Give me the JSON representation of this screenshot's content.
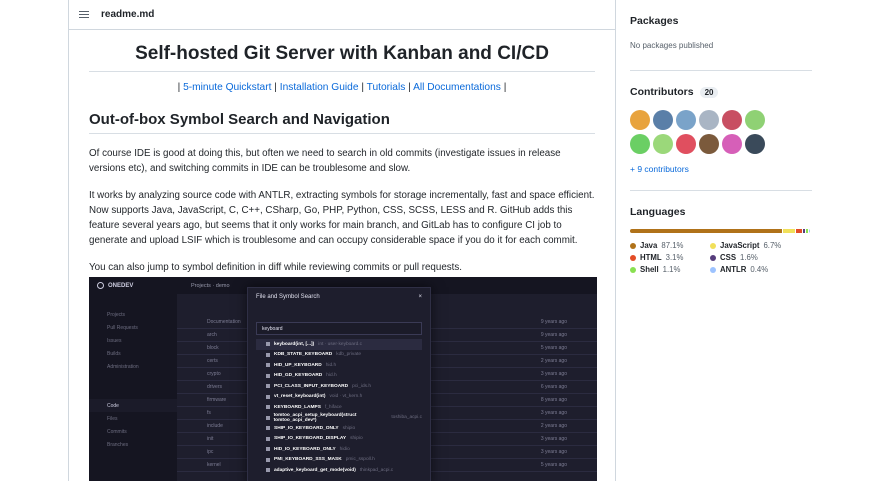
{
  "readme": {
    "file_name": "readme.md",
    "title": "Self-hosted Git Server with Kanban and CI/CD",
    "links": [
      "5-minute Quickstart",
      "Installation Guide",
      "Tutorials",
      "All Documentations"
    ],
    "section_heading": "Out-of-box Symbol Search and Navigation",
    "paragraphs": [
      "Of course IDE is good at doing this, but often we need to search in old commits (investigate issues in release versions etc), and switching commits in IDE can be troublesome and slow.",
      "It works by analyzing source code with ANTLR, extracting symbols for storage incrementally, fast and space efficient. Now supports Java, JavaScript, C, C++, CSharp, Go, PHP, Python, CSS, SCSS, LESS and R. GitHub adds this feature several years ago, but seems that it only works for main branch, and GitLab has to configure CI job to generate and upload LSIF which is troublesome and can occupy considerable space if you do it for each commit.",
      "You can also jump to symbol definition in diff while reviewing commits or pull requests."
    ]
  },
  "screenshot": {
    "logo": "ONEDEV",
    "breadcrumb": "Projects · demo",
    "side_items": [
      "Projects",
      "Pull Requests",
      "Issues",
      "Builds",
      "Administration",
      "",
      "",
      "Code",
      "Files",
      "Commits",
      "Branches"
    ],
    "files": [
      {
        "name": "Documentation",
        "time": "9 years ago"
      },
      {
        "name": "arch",
        "time": "9 years ago"
      },
      {
        "name": "block",
        "time": "5 years ago"
      },
      {
        "name": "certs",
        "time": "2 years ago"
      },
      {
        "name": "crypto",
        "time": "3 years ago"
      },
      {
        "name": "drivers",
        "time": "6 years ago"
      },
      {
        "name": "firmware",
        "time": "8 years ago"
      },
      {
        "name": "fs",
        "time": "3 years ago"
      },
      {
        "name": "include",
        "time": "2 years ago"
      },
      {
        "name": "init",
        "time": "3 years ago"
      },
      {
        "name": "ipc",
        "time": "3 years ago"
      },
      {
        "name": "kernel",
        "time": "5 years ago"
      }
    ],
    "modal": {
      "title": "File and Symbol Search",
      "close": "×",
      "query": "keyboard",
      "results": [
        {
          "name": "keyboard(int, [...])",
          "path": "int · user·keyboard.c"
        },
        {
          "name": "KDB_STATE_KEYBOARD",
          "path": "kdb_private"
        },
        {
          "name": "HID_UP_KEYBOARD",
          "path": "hid.h"
        },
        {
          "name": "HID_GD_KEYBOARD",
          "path": "hid.h"
        },
        {
          "name": "PCI_CLASS_INPUT_KEYBOARD",
          "path": "pci_ids.h"
        },
        {
          "name": "vt_reset_keyboard(int)",
          "path": "void · vt_kern.h"
        },
        {
          "name": "KEYBOARD_LAMPS",
          "path": "f_hiface"
        },
        {
          "name": "tomtoo_acpi_setup_keyboard(struct tomtoo_acpi_dev*)",
          "path": "toshiba_acpi.c"
        },
        {
          "name": "SHIP_IO_KEYBOARD_ONLY",
          "path": "shipio"
        },
        {
          "name": "SHIP_IO_KEYBOARD_DISPLAY",
          "path": "shipio"
        },
        {
          "name": "HID_IO_KEYBOARD_ONLY",
          "path": "hidio"
        },
        {
          "name": "PMI_KEYBOARD_SSS_MASK",
          "path": "pmic_sspoll.h"
        },
        {
          "name": "adaptive_keyboard_get_mode(void)",
          "path": "thinkpad_acpi.c"
        }
      ]
    }
  },
  "sidebar": {
    "packages_title": "Packages",
    "packages_empty": "No packages published",
    "contributors_title": "Contributors",
    "contributors_count": "20",
    "contributors_more": "+ 9 contributors",
    "avatars": [
      {
        "name": "avatar-1",
        "color": "#e8a33d"
      },
      {
        "name": "avatar-2",
        "color": "#5a7fa8"
      },
      {
        "name": "avatar-3",
        "color": "#7aa3c9"
      },
      {
        "name": "avatar-4",
        "color": "#a9b5c4"
      },
      {
        "name": "avatar-5",
        "color": "#c84f62"
      },
      {
        "name": "avatar-6",
        "color": "#8fd174"
      },
      {
        "name": "avatar-7",
        "color": "#6bcf64"
      },
      {
        "name": "avatar-8",
        "color": "#9bd87a"
      },
      {
        "name": "avatar-9",
        "color": "#e04f5f"
      },
      {
        "name": "avatar-10",
        "color": "#7b5a3c"
      },
      {
        "name": "avatar-11",
        "color": "#d65fb8"
      },
      {
        "name": "avatar-12",
        "color": "#3a4a5a"
      }
    ],
    "languages_title": "Languages",
    "languages": [
      {
        "name": "Java",
        "pct": "87.1%",
        "value": 87.1,
        "color": "#b07219"
      },
      {
        "name": "JavaScript",
        "pct": "6.7%",
        "value": 6.7,
        "color": "#f1e05a"
      },
      {
        "name": "HTML",
        "pct": "3.1%",
        "value": 3.1,
        "color": "#e34c26"
      },
      {
        "name": "CSS",
        "pct": "1.6%",
        "value": 1.6,
        "color": "#563d7c"
      },
      {
        "name": "Shell",
        "pct": "1.1%",
        "value": 1.1,
        "color": "#89e051"
      },
      {
        "name": "ANTLR",
        "pct": "0.4%",
        "value": 0.4,
        "color": "#9dc3ff"
      }
    ]
  }
}
